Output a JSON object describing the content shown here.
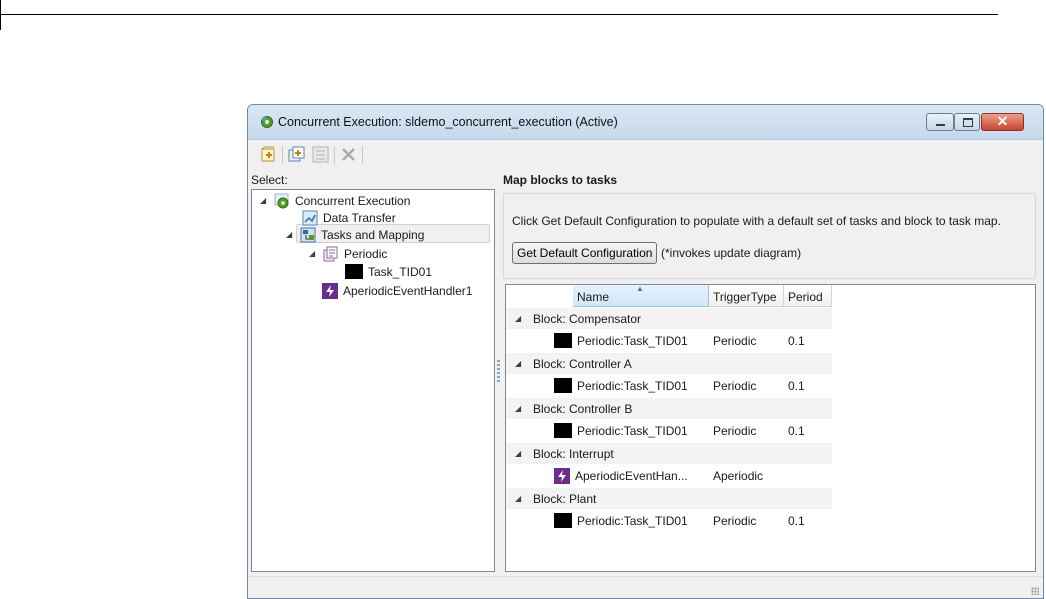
{
  "window": {
    "title": "Concurrent Execution: sldemo_concurrent_execution (Active)",
    "close_symbol": "✕"
  },
  "left_panel": {
    "select_label": "Select:",
    "tree": [
      {
        "label": "Concurrent Execution",
        "icon": "gear-icon"
      },
      {
        "label": "Data Transfer",
        "icon": "data-transfer-icon"
      },
      {
        "label": "Tasks and Mapping",
        "icon": "tasks-mapping-icon",
        "selected": true
      },
      {
        "label": "Periodic",
        "icon": "periodic-icon"
      },
      {
        "label": "Task_TID01",
        "icon": "task-color-icon"
      },
      {
        "label": "AperiodicEventHandler1",
        "icon": "lightning-icon"
      }
    ]
  },
  "right_panel": {
    "header": "Map blocks to tasks",
    "instruction": "Click Get Default Configuration to populate with a default set of tasks and block to task map.",
    "button": "Get Default Configuration",
    "note": "(*invokes update diagram)",
    "columns": [
      "Name",
      "TriggerType",
      "Period"
    ],
    "groups": [
      {
        "label": "Block: Compensator",
        "name": "Periodic:Task_TID01",
        "trigger": "Periodic",
        "period": "0.1",
        "icon": "task-color-icon"
      },
      {
        "label": "Block: Controller A",
        "name": "Periodic:Task_TID01",
        "trigger": "Periodic",
        "period": "0.1",
        "icon": "task-color-icon"
      },
      {
        "label": "Block: Controller B",
        "name": "Periodic:Task_TID01",
        "trigger": "Periodic",
        "period": "0.1",
        "icon": "task-color-icon"
      },
      {
        "label": "Block: Interrupt",
        "name": "AperiodicEventHan...",
        "trigger": "Aperiodic",
        "period": "",
        "icon": "lightning-icon"
      },
      {
        "label": "Block: Plant",
        "name": "Periodic:Task_TID01",
        "trigger": "Periodic",
        "period": "0.1",
        "icon": "task-color-icon"
      }
    ]
  },
  "colors": {
    "titlebar": "#c6d8ec",
    "selection": "#f0f0f0",
    "lightning_icon": "#6b2d8b",
    "task_color": "#000000"
  }
}
